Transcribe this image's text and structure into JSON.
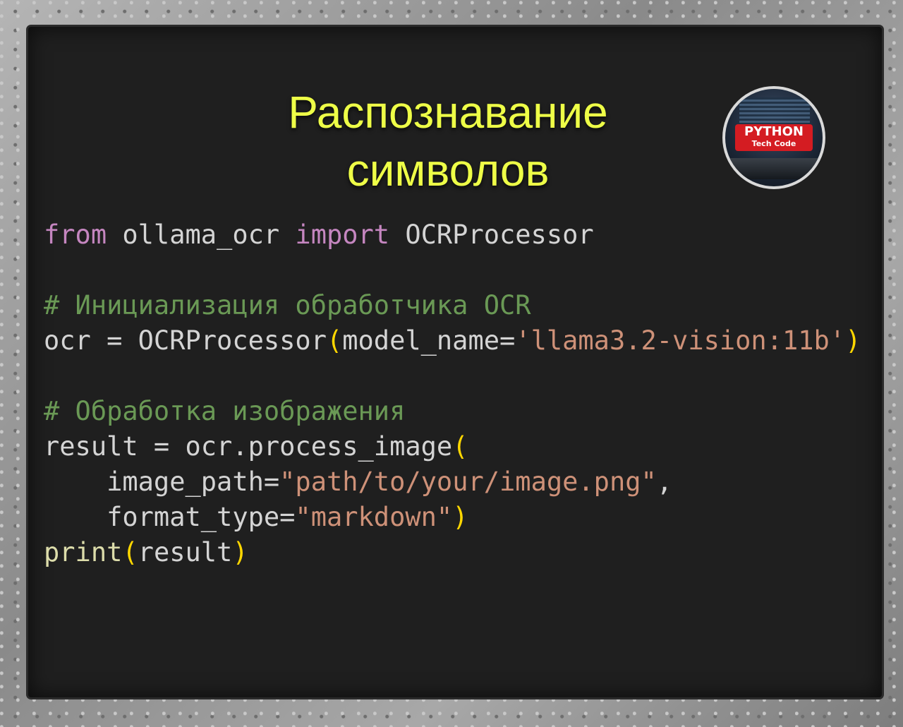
{
  "title": {
    "line1": "Распознавание",
    "line2": "символов"
  },
  "logo": {
    "text_primary": "PYTHON",
    "text_secondary": "Tech Code",
    "badge_color": "#d41c22"
  },
  "code": {
    "line1": {
      "kw_from": "from",
      "module": " ollama_ocr ",
      "kw_import": "import",
      "name": " OCRProcessor"
    },
    "comment1": "# Инициализация обработчика OCR",
    "line3": {
      "head": "ocr = OCRProcessor",
      "open": "(",
      "arg": "model_name=",
      "str": "'llama3.2-vision:11b'",
      "close": ")"
    },
    "comment2": "# Обработка изображения",
    "line5": {
      "head": "result = ocr.process_image",
      "open": "("
    },
    "line6": {
      "indent": "    ",
      "arg": "image_path=",
      "str": "\"path/to/your/image.png\"",
      "tail": ","
    },
    "line7": {
      "indent": "    ",
      "arg": "format_type=",
      "str": "\"markdown\"",
      "close": ")"
    },
    "line8": {
      "fn": "print",
      "open": "(",
      "arg": "result",
      "close": ")"
    }
  },
  "colors": {
    "background": "#1f1f1f",
    "title": "#eeff47",
    "keyword": "#c586c0",
    "comment": "#6a9955",
    "string": "#ce9178",
    "bracket": "#ffd700",
    "text": "#d4d4d4"
  }
}
